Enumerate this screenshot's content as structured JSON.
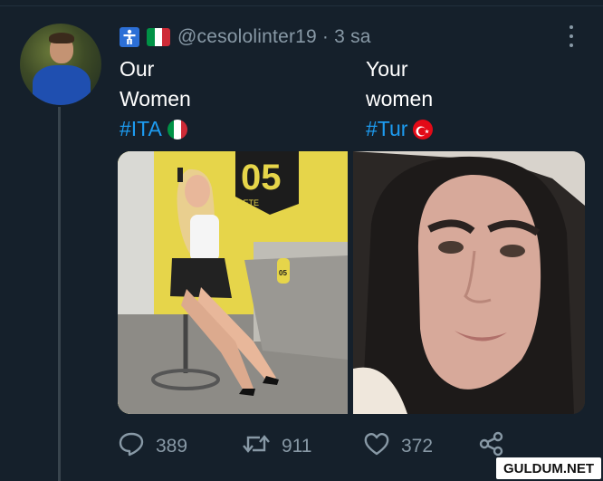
{
  "tweet": {
    "handle": "@cesololinter19 · 3 sa",
    "left_text": {
      "line1": "Our",
      "line2": "Women",
      "hashtag": "#ITA"
    },
    "right_text": {
      "line1": "Your",
      "line2": "women",
      "hashtag": "#Tur"
    },
    "media_left": {
      "sign_text": "05",
      "sign_subtext": "RETE",
      "mic_text": "05"
    }
  },
  "actions": {
    "replies": "389",
    "retweets": "911",
    "likes": "372"
  },
  "icons": {
    "accessibility": "accessibility-icon",
    "italy_flag": "italy-flag-icon",
    "more": "more-options-icon",
    "reply": "reply-icon",
    "retweet": "retweet-icon",
    "like": "heart-icon",
    "share": "share-icon"
  },
  "colors": {
    "background": "#15202b",
    "accent": "#1d9bf0",
    "muted": "#8899a6",
    "italy_green": "#009246",
    "italy_white": "#ffffff",
    "italy_red": "#ce2b37",
    "turkey_red": "#e30a17"
  },
  "watermark": "GULDUM.NET"
}
